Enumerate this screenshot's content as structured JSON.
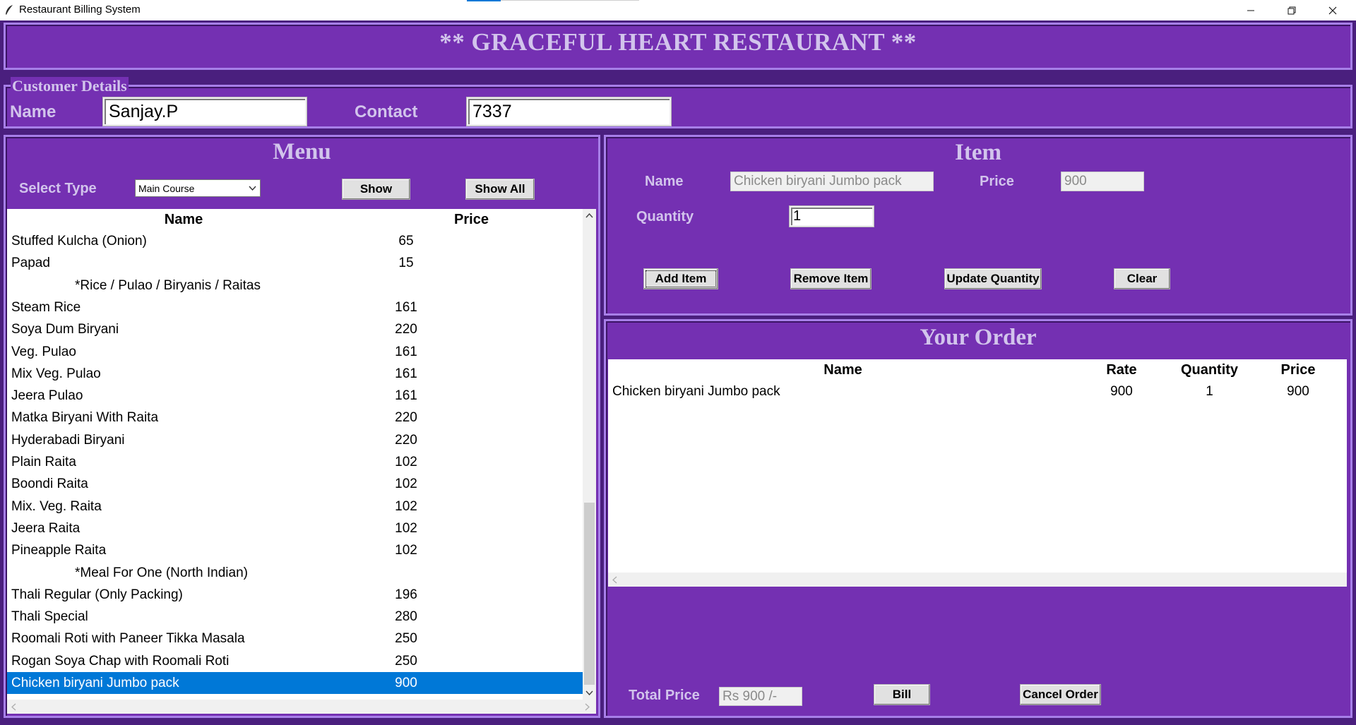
{
  "window": {
    "title": "Restaurant Billing System",
    "minimize_icon": "minimize-icon",
    "maximize_icon": "restore-icon",
    "close_icon": "close-icon"
  },
  "header": {
    "title": "** GRACEFUL HEART RESTAURANT **"
  },
  "customer": {
    "legend": "Customer Details",
    "name_label": "Name",
    "name_value": "Sanjay.P",
    "contact_label": "Contact",
    "contact_value": "7337"
  },
  "menu": {
    "title": "Menu",
    "select_type_label": "Select Type",
    "select_type_value": "Main Course",
    "show_button": "Show",
    "show_all_button": "Show All",
    "columns": [
      "Name",
      "Price"
    ],
    "rows": [
      {
        "name": "Stuffed Kulcha (Onion)",
        "price": "65"
      },
      {
        "name": "Papad",
        "price": "15"
      },
      {
        "name": "*Rice / Pulao / Biryanis / Raitas",
        "price": "",
        "category": true
      },
      {
        "name": "Steam Rice",
        "price": "161"
      },
      {
        "name": "Soya Dum Biryani",
        "price": "220"
      },
      {
        "name": "Veg. Pulao",
        "price": "161"
      },
      {
        "name": "Mix Veg. Pulao",
        "price": "161"
      },
      {
        "name": "Jeera Pulao",
        "price": "161"
      },
      {
        "name": "Matka Biryani With Raita",
        "price": "220"
      },
      {
        "name": "Hyderabadi Biryani",
        "price": "220"
      },
      {
        "name": "Plain Raita",
        "price": "102"
      },
      {
        "name": "Boondi Raita",
        "price": "102"
      },
      {
        "name": "Mix. Veg. Raita",
        "price": "102"
      },
      {
        "name": "Jeera Raita",
        "price": "102"
      },
      {
        "name": "Pineapple Raita",
        "price": "102"
      },
      {
        "name": "*Meal For One (North Indian)",
        "price": "",
        "category": true
      },
      {
        "name": "Thali Regular (Only Packing)",
        "price": "196"
      },
      {
        "name": "Thali Special",
        "price": "280"
      },
      {
        "name": "Roomali Roti with Paneer Tikka Masala",
        "price": "250"
      },
      {
        "name": "Rogan Soya Chap with Roomali Roti",
        "price": "250"
      },
      {
        "name": "Chicken biryani Jumbo pack",
        "price": "900",
        "selected": true
      }
    ]
  },
  "item": {
    "title": "Item",
    "name_label": "Name",
    "name_value": "Chicken biryani Jumbo pack",
    "price_label": "Price",
    "price_value": "900",
    "quantity_label": "Quantity",
    "quantity_value": "1",
    "add_button": "Add Item",
    "remove_button": "Remove Item",
    "update_button": "Update Quantity",
    "clear_button": "Clear"
  },
  "order": {
    "title": "Your Order",
    "columns": [
      "Name",
      "Rate",
      "Quantity",
      "Price"
    ],
    "rows": [
      {
        "name": "Chicken biryani Jumbo pack",
        "rate": "900",
        "quantity": "1",
        "price": "900"
      }
    ],
    "total_label": "Total Price",
    "total_value": "Rs 900  /-",
    "bill_button": "Bill",
    "cancel_button": "Cancel Order"
  },
  "colors": {
    "frame_bg": "#7430b2",
    "frame_border": "#a77fe8",
    "label_text": "#d2c4ec",
    "selection": "#0078d7"
  }
}
